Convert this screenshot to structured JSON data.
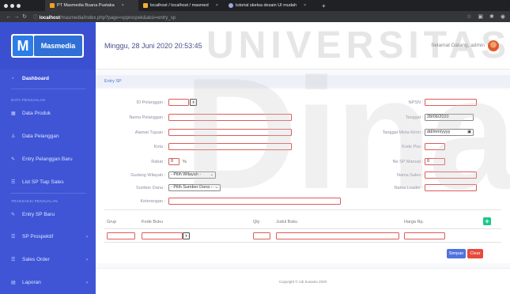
{
  "browser": {
    "tabs": [
      {
        "label": "PT Masmedia Buana Pustaka",
        "active": true,
        "favicon_color": "#f4a21a"
      },
      {
        "label": "localhost / localhost / masmed",
        "active": false,
        "favicon_color": "#f0b030"
      },
      {
        "label": "tutorial sketsa desain UI mudah",
        "active": false,
        "favicon_color": "#9ad"
      }
    ],
    "new_tab": "+",
    "url_host": "localhost",
    "url_path": "/masmedia/index.php?page=spprospek&aksi=entry_sp"
  },
  "header": {
    "datetime": "Minggu, 28 Juni 2020 20:53:45",
    "watermark": "UNIVERSITAS",
    "greeting": "Selamat Datang, admin"
  },
  "sidebar": {
    "logo_text": "Masmedia",
    "dashboard": "Dashboard",
    "section_data": "DATA PENJUALAN",
    "data_produk": "Data Produk",
    "data_pelanggan": "Data Pelanggan",
    "entry_pelanggan": "Entry Pelanggan Baru",
    "list_sp": "List SP Tiap Sales",
    "section_transaksi": "TRANSAKSI PENJUALAN",
    "entry_sp": "Entry SP Baru",
    "sp_prospektif": "SP Prospektif",
    "sales_order": "Sales Order",
    "laporan": "Laporan"
  },
  "form": {
    "breadcrumb": "Entry SP",
    "id_pelanggan": "ID Pelanggan :",
    "nama_pelanggan": "Nama Pelanggan :",
    "alamat_tujuan": "Alamat Tujuan :",
    "kota": "Kota :",
    "rabat": "Rabat :",
    "rabat_value": "0",
    "rabat_unit": "%",
    "gudang_wilayah": "Gudang Wilayah :",
    "gudang_option": "- Pilih Wilayah -",
    "sumber_dana": "Sumber Dana :",
    "sumber_option": "- Pilih Sumber Dana -",
    "keterangan": "Keterangan :",
    "npsn": "NPSN :",
    "tanggal": "Tanggal :",
    "tanggal_value": "28/06/2020",
    "tanggal_minta": "Tanggal Minta Kirim :",
    "tanggal_minta_value": "dd/mm/yyyy",
    "kode_pos": "Kode Pos :",
    "no_sp_manual": "No SP Manual :",
    "no_sp_value": "0",
    "nama_sales": "Nama Sales :",
    "nama_leader": "Nama Leader :",
    "browse_glyph": "›"
  },
  "table": {
    "headers": [
      "Grup",
      "Kode Buku",
      "Qty",
      "Judul Buku",
      "Harga Rp."
    ],
    "add": "+"
  },
  "buttons": {
    "simpan": "Simpan",
    "clear": "Clear"
  },
  "footer": "Copyright © Adi Susanto 2020",
  "overlay": "Dinam"
}
